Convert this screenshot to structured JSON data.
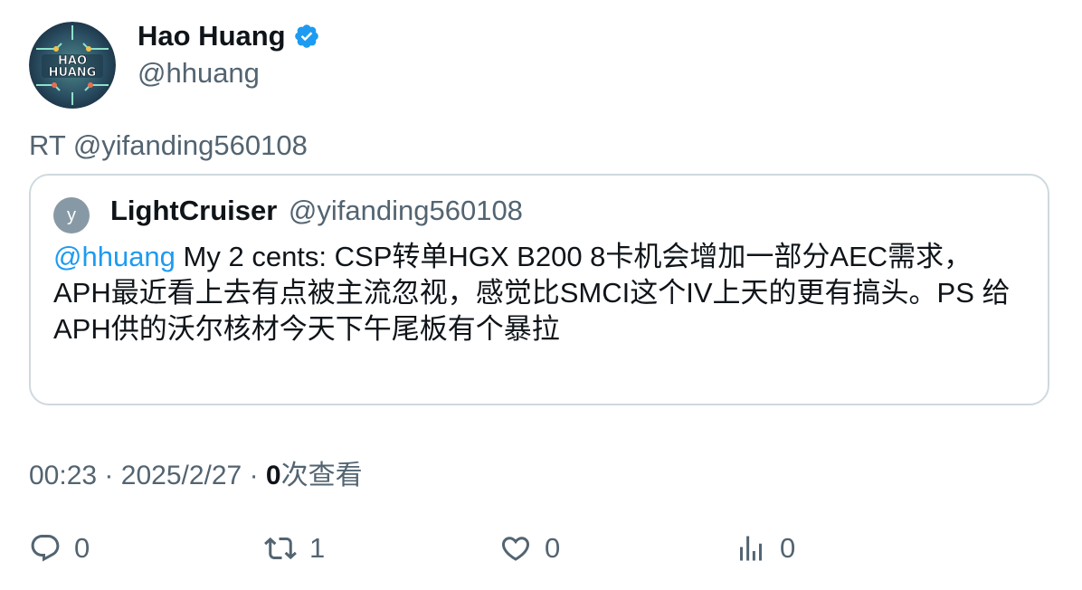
{
  "author": {
    "name": "Hao Huang",
    "handle": "@hhuang",
    "avatar_text_top": "HAO",
    "avatar_text_bottom": "HUANG"
  },
  "retweet_line": "RT @yifanding560108",
  "quote": {
    "avatar_letter": "y",
    "name": "LightCruiser",
    "handle": "@yifanding560108",
    "mention": "@hhuang",
    "text": " My 2 cents: CSP转单HGX B200 8卡机会增加一部分AEC需求，APH最近看上去有点被主流忽视，感觉比SMCI这个IV上天的更有搞头。PS 给APH供的沃尔核材今天下午尾板有个暴拉"
  },
  "meta": {
    "time": "00:23",
    "separator": "·",
    "date": "2025/2/27",
    "views_count": "0",
    "views_label": "次查看"
  },
  "actions": {
    "reply_count": "0",
    "retweet_count": "1",
    "like_count": "0",
    "views_count": "0"
  },
  "colors": {
    "accent": "#1d9bf0",
    "muted": "#536471",
    "border": "#cfd9de"
  }
}
